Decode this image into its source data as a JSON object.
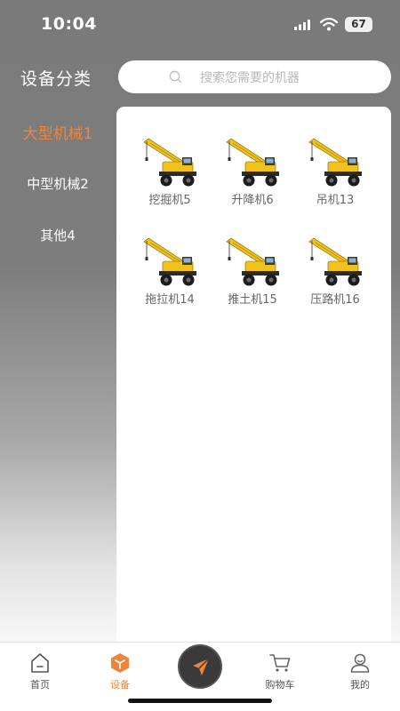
{
  "status_bar": {
    "time": "10:04",
    "battery": "67"
  },
  "sidebar": {
    "title": "设备分类",
    "items": [
      {
        "label": "大型机械1",
        "active": true
      },
      {
        "label": "中型机械2",
        "active": false
      },
      {
        "label": "其他4",
        "active": false
      }
    ]
  },
  "search": {
    "placeholder": "搜索您需要的机器",
    "value": ""
  },
  "equipment": [
    {
      "label": "挖掘机5",
      "icon": "crane-icon"
    },
    {
      "label": "升降机6",
      "icon": "crane-icon"
    },
    {
      "label": "吊机13",
      "icon": "crane-icon"
    },
    {
      "label": "拖拉机14",
      "icon": "crane-icon"
    },
    {
      "label": "推土机15",
      "icon": "crane-icon"
    },
    {
      "label": "压路机16",
      "icon": "crane-icon"
    }
  ],
  "tabbar": {
    "items": [
      {
        "label": "首页",
        "icon": "home-icon",
        "active": false
      },
      {
        "label": "设备",
        "icon": "equipment-cube-icon",
        "active": true
      },
      {
        "label": "",
        "icon": "send-icon",
        "active": false
      },
      {
        "label": "购物车",
        "icon": "cart-icon",
        "active": false
      },
      {
        "label": "我的",
        "icon": "profile-icon",
        "active": false
      }
    ]
  },
  "colors": {
    "accent": "#f0843c",
    "sidebar_bg": "#7a7a7a",
    "panel_bg": "#ffffff"
  }
}
